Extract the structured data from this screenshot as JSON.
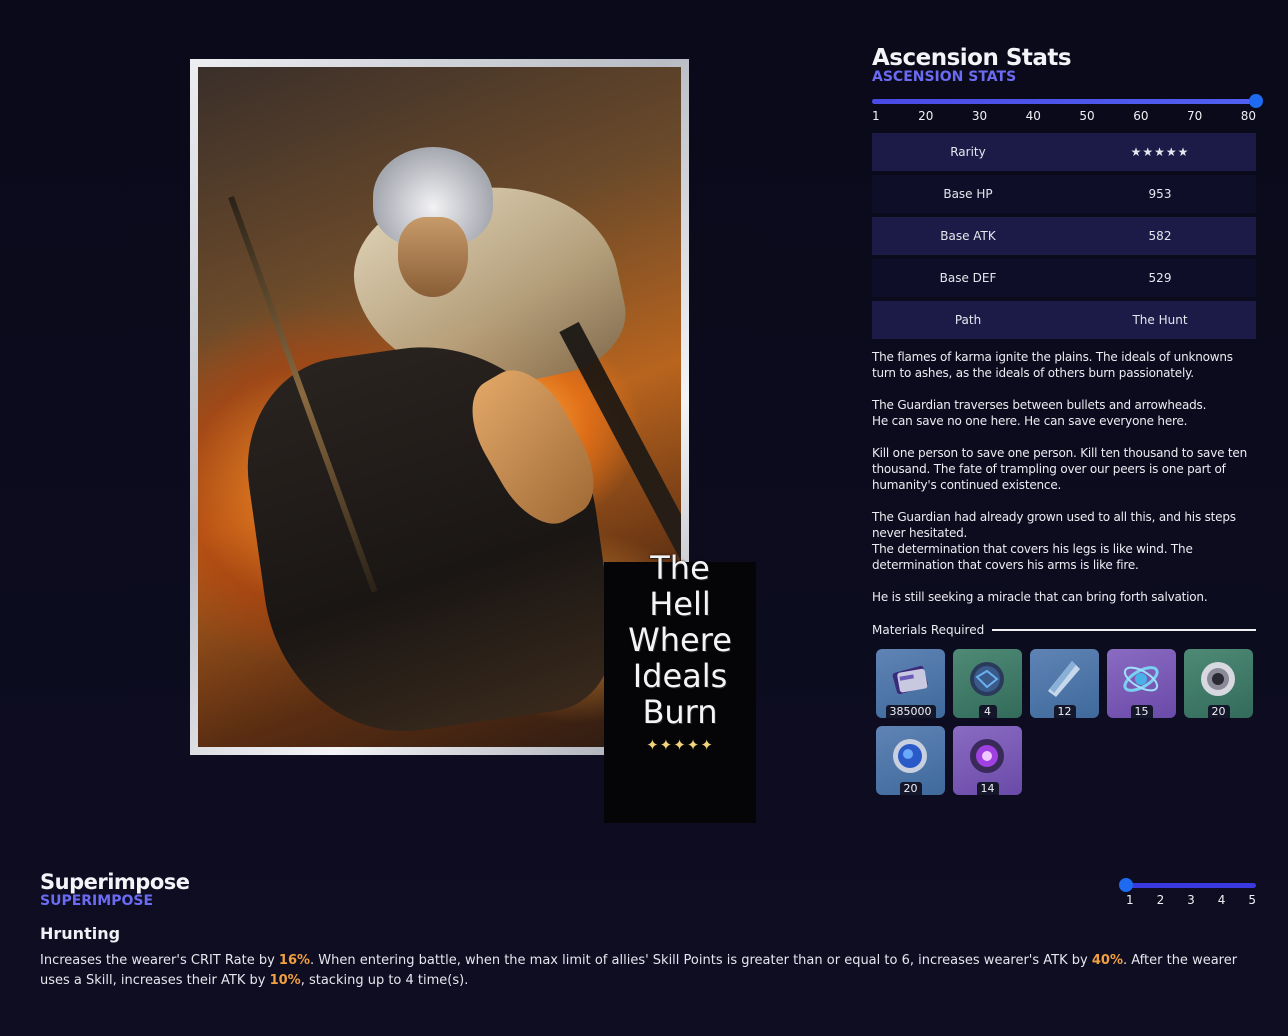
{
  "card": {
    "title": "The Hell Where Ideals Burn",
    "title_lines": [
      "The",
      "Hell",
      "Where",
      "Ideals",
      "Burn"
    ],
    "stars": "✦✦✦✦✦"
  },
  "ascension": {
    "title": "Ascension Stats",
    "subtitle": "ASCENSION STATS",
    "level_ticks": [
      "1",
      "20",
      "30",
      "40",
      "50",
      "60",
      "70",
      "80"
    ],
    "current_level": 80,
    "stats": [
      {
        "label": "Rarity",
        "value": "★★★★★"
      },
      {
        "label": "Base HP",
        "value": "953"
      },
      {
        "label": "Base ATK",
        "value": "582"
      },
      {
        "label": "Base DEF",
        "value": "529"
      },
      {
        "label": "Path",
        "value": "The Hunt"
      }
    ],
    "lore": "The flames of karma ignite the plains. The ideals of unknowns turn to ashes, as the ideals of others burn passionately.\n\nThe Guardian traverses between bullets and arrowheads.\nHe can save no one here. He can save everyone here.\n\nKill one person to save one person. Kill ten thousand to save ten thousand. The fate of trampling over our peers is one part of humanity's continued existence.\n\nThe Guardian had already grown used to all this, and his steps never hesitated.\nThe determination that covers his legs is like wind. The determination that covers his arms is like fire.\n\nHe is still seeking a miracle that can bring forth salvation.",
    "materials_label": "Materials Required",
    "materials": [
      {
        "icon": "credit-card-icon",
        "count": "385000",
        "bg": "blue"
      },
      {
        "icon": "dark-orb-icon",
        "count": "4",
        "bg": "green"
      },
      {
        "icon": "crystal-shard-icon",
        "count": "12",
        "bg": "blue"
      },
      {
        "icon": "blue-nexus-icon",
        "count": "15",
        "bg": "purple"
      },
      {
        "icon": "silver-spiral-icon",
        "count": "20",
        "bg": "green"
      },
      {
        "icon": "blue-arrowhead-icon",
        "count": "20",
        "bg": "blue"
      },
      {
        "icon": "purple-core-icon",
        "count": "14",
        "bg": "purple"
      }
    ]
  },
  "superimpose": {
    "title": "Superimpose",
    "subtitle": "SUPERIMPOSE",
    "ticks": [
      "1",
      "2",
      "3",
      "4",
      "5"
    ],
    "current": 1,
    "skill_name": "Hrunting",
    "desc": {
      "p1": "Increases the wearer's CRIT Rate by ",
      "v1": "16%",
      "p2": ". When entering battle, when the max limit of allies' Skill Points is greater than or equal to 6, increases wearer's ATK by ",
      "v2": "40%",
      "p3": ". After the wearer uses a Skill, increases their ATK by ",
      "v3": "10%",
      "p4": ", stacking up to 4 time(s)."
    }
  },
  "colors": {
    "accent": "#6b6bf2",
    "slider": "#3a3ae0",
    "highlight": "#f0a040",
    "star": "#f2d27a"
  }
}
